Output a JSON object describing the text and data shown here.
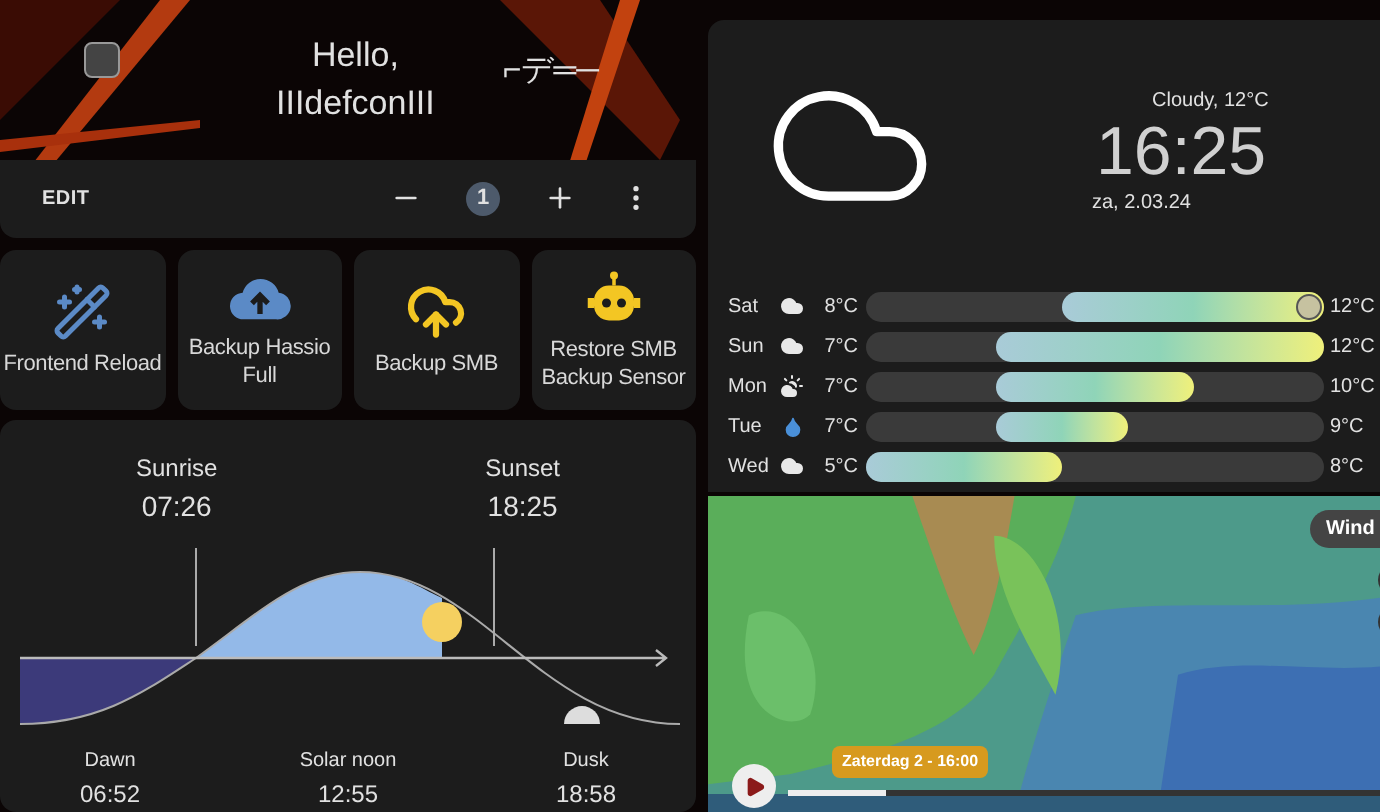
{
  "header": {
    "greeting": "Hello,",
    "user": "IIIdefconIII",
    "badge_text": "⌐デ═─"
  },
  "toolbar": {
    "edit": "EDIT",
    "count": "1"
  },
  "shortcuts": [
    {
      "label": "Frontend Reload",
      "kind": "wand"
    },
    {
      "label": "Backup Hassio Full",
      "kind": "cloud-upload"
    },
    {
      "label": "Backup SMB",
      "kind": "cloud-outline"
    },
    {
      "label": "Restore SMB Backup Sensor",
      "kind": "robot"
    }
  ],
  "sun": {
    "sunrise_label": "Sunrise",
    "sunrise": "07:26",
    "sunset_label": "Sunset",
    "sunset": "18:25",
    "dawn_label": "Dawn",
    "dawn": "06:52",
    "noon_label": "Solar noon",
    "noon": "12:55",
    "dusk_label": "Dusk",
    "dusk": "18:58"
  },
  "weather": {
    "condition": "Cloudy, 12°C",
    "time": "16:25",
    "date": "za, 2.03.24",
    "forecast": [
      {
        "day": "Sat",
        "kind": "cloudy",
        "low": "8°C",
        "high": "12°C",
        "current": true
      },
      {
        "day": "Sun",
        "kind": "cloudy",
        "low": "7°C",
        "high": "12°C",
        "current": false
      },
      {
        "day": "Mon",
        "kind": "partly-cloudy",
        "low": "7°C",
        "high": "10°C",
        "current": false
      },
      {
        "day": "Tue",
        "kind": "rain",
        "low": "7°C",
        "high": "9°C",
        "current": false
      },
      {
        "day": "Wed",
        "kind": "cloudy",
        "low": "5°C",
        "high": "8°C",
        "current": false
      }
    ]
  },
  "map": {
    "kind": "picture",
    "layer": "Wind",
    "timestamp": "Zaterdag 2 - 16:00",
    "level": 0.16
  }
}
